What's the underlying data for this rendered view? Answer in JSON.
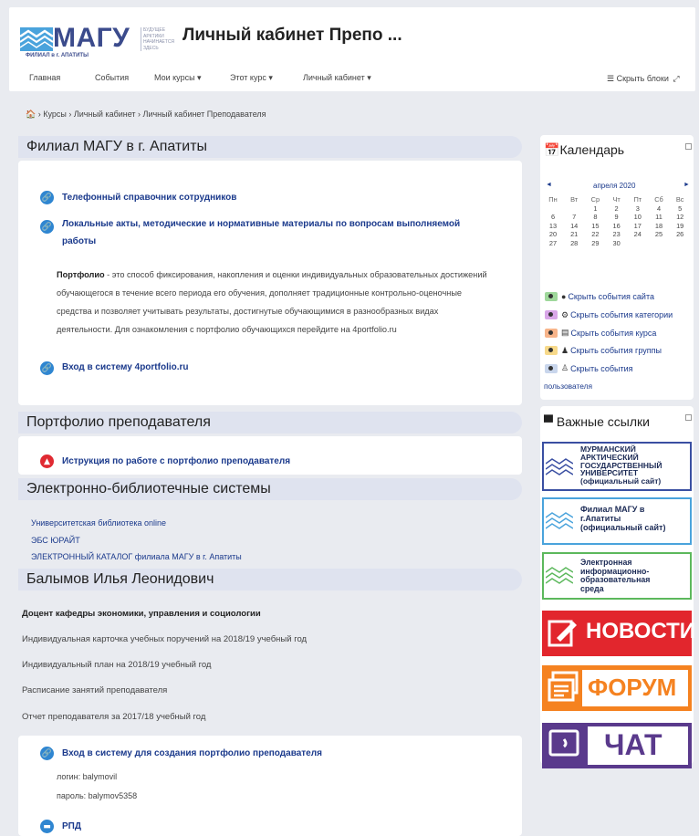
{
  "header": {
    "logo_big": "МАГУ",
    "logo_sub": "ФИЛИАЛ в г. АПАТИТЫ",
    "logo_motto": [
      "БУДУЩЕЕ",
      "АРКТИКИ",
      "НАЧИНАЕТСЯ",
      "ЗДЕСЬ"
    ],
    "site_title": "Личный кабинет Препо ...",
    "nav": [
      "Главная",
      "События",
      "Мои курсы ▾",
      "Этот курс ▾",
      "Личный кабинет ▾"
    ],
    "hide_blocks": "Скрыть блоки"
  },
  "breadcrumb": "› Курсы › Личный кабинет › Личный кабинет Преподавателя",
  "main": {
    "section1_title": "Филиал МАГУ в г. Апатиты",
    "link_phonebook": "Телефонный справочник сотрудников",
    "link_acts_1": "Локальные акты, методические и нормативные материалы по вопросам выполняемой",
    "link_acts_2": "работы",
    "portfolio_bold": "Портфолио",
    "portfolio_text": " - это способ фиксирования, накопления и оценки индивидуальных образовательных достижений обучающегося в течение всего периода его обучения, дополняет традиционные контрольно-оценочные средства и позволяет учитывать результаты, достигнутые обучающимися в разнообразных видах деятельности. Для ознакомления с портфолио обучающихся перейдите на 4portfolio.ru",
    "link_4portfolio": "Вход в систему 4portfolio.ru",
    "section2_title": "Портфолио преподавателя",
    "link_instruction": "Иструкция по работе с портфолио преподавателя",
    "section3_title": "Электронно-библиотечные системы",
    "libraries": [
      "Университетская библиотека online",
      "ЭБС ЮРАЙТ",
      "ЭЛЕКТРОННЫЙ КАТАЛОГ филиала МАГУ в г. Апатиты"
    ],
    "section4_title": "Балымов Илья Леонидович",
    "position": "Доцент кафедры экономики, управления и социологии",
    "teacher_links": [
      "Индивидуальная карточка учебных поручений на 2018/19 учебный год",
      "Индивидуальный план на 2018/19 учебный год",
      "Расписание занятий преподавателя",
      "Отчет преподавателя за 2017/18 учебный год"
    ],
    "link_portfolio_login": "Вход в систему для создания портфолио преподавателя",
    "login": "логин: balymovil",
    "password": "пароль: balymov5358",
    "link_rpd": "РПД"
  },
  "calendar": {
    "title": "Календарь",
    "month": "апреля 2020",
    "weekdays": [
      "Пн",
      "Вт",
      "Ср",
      "Чт",
      "Пт",
      "Сб",
      "Вс"
    ],
    "weeks": [
      [
        "",
        "",
        "1",
        "2",
        "3",
        "4",
        "5"
      ],
      [
        "6",
        "7",
        "8",
        "9",
        "10",
        "11",
        "12"
      ],
      [
        "13",
        "14",
        "15",
        "16",
        "17",
        "18",
        "19"
      ],
      [
        "20",
        "21",
        "22",
        "23",
        "24",
        "25",
        "26"
      ],
      [
        "27",
        "28",
        "29",
        "30",
        "",
        "",
        ""
      ]
    ],
    "events": [
      {
        "label": "Скрыть события сайта",
        "color": "#9fd89b"
      },
      {
        "label": "Скрыть события категории",
        "color": "#d9a6e8"
      },
      {
        "label": "Скрыть события курса",
        "color": "#f7b48a"
      },
      {
        "label": "Скрыть события группы",
        "color": "#f7d98a"
      },
      {
        "label": "Скрыть события",
        "color": "#c9d6ec"
      }
    ],
    "events_tail": "пользователя"
  },
  "important_links": {
    "title": "Важные ссылки",
    "banner1": [
      "МУРМАНСКИЙ",
      "АРКТИЧЕСКИЙ",
      "ГОСУДАРСТВЕННЫЙ",
      "УНИВЕРСИТЕТ",
      "(официальный сайт)"
    ],
    "banner2": [
      "Филиал МАГУ в",
      "г.Апатиты",
      "(официальный сайт)"
    ],
    "banner3": [
      "Электронная",
      "информационно-",
      "образовательная",
      "среда"
    ],
    "news": "НОВОСТИ",
    "forum": "ФОРУМ",
    "chat": "ЧАТ",
    "colors": {
      "blue": "#3a4fa2",
      "lightblue": "#4aa3dc",
      "green": "#5cb85c",
      "red": "#e2262d",
      "orange": "#f58220",
      "purple": "#5a3a8c"
    }
  }
}
